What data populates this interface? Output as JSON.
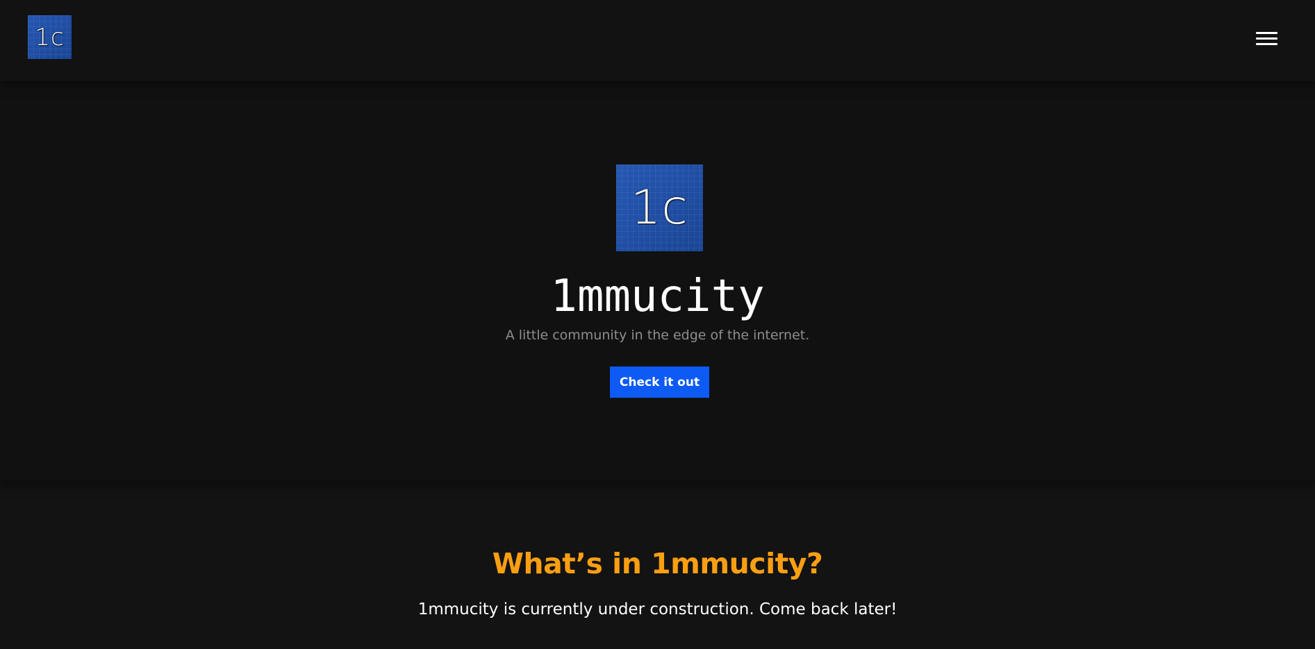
{
  "navbar": {
    "logo_text": "1c",
    "menu_icon": "hamburger-menu-icon"
  },
  "hero": {
    "logo_text": "1c",
    "title": "1mmucity",
    "tagline": "A little community in the edge of the internet.",
    "cta_label": "Check it out"
  },
  "about": {
    "heading": "What’s in 1mmucity?",
    "body": "1mmucity is currently under construction. Come back later!"
  },
  "colors": {
    "background": "#131313",
    "logo_blue": "#1c4fa3",
    "cta_blue": "#0d5af5",
    "heading_orange": "#fa9f12",
    "tagline_gray": "#8e8e8e"
  }
}
